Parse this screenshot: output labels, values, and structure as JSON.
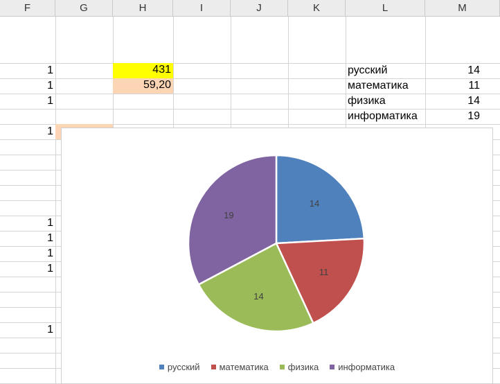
{
  "columns": [
    "F",
    "G",
    "H",
    "I",
    "J",
    "K",
    "L",
    "M"
  ],
  "col_f_values": [
    "1",
    "1",
    "1",
    "1",
    "1",
    "1",
    "1",
    "1",
    "1"
  ],
  "cells": {
    "h_total": "431",
    "h_average": "59,20"
  },
  "colors": {
    "highlight_yellow": "#FFFF00",
    "highlight_peach": "#FCD5B4",
    "series": [
      "#4F81BD",
      "#C0504D",
      "#9BBB59",
      "#8064A2"
    ]
  },
  "chart_data": {
    "type": "pie",
    "categories": [
      "русский",
      "математика",
      "физика",
      "информатика"
    ],
    "values": [
      14,
      11,
      14,
      19
    ],
    "data_labels": [
      "14",
      "11",
      "14",
      "19"
    ],
    "legend": "bottom"
  }
}
